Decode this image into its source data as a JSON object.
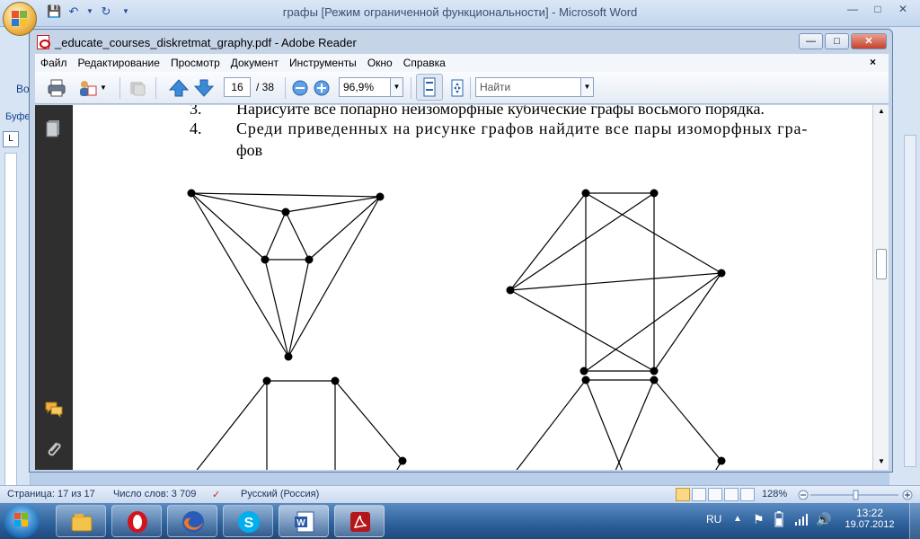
{
  "word": {
    "title": "графы [Режим ограниченной функциональности] - Microsoft Word",
    "left_label_1": "Во",
    "left_label_2": "Буфе",
    "ruler_button": "L"
  },
  "reader": {
    "title": "_educate_courses_diskretmat_graphy.pdf - Adobe Reader",
    "menu": [
      "Файл",
      "Редактирование",
      "Просмотр",
      "Документ",
      "Инструменты",
      "Окно",
      "Справка"
    ],
    "menu_close": "×",
    "page_current": "16",
    "page_total": "/ 38",
    "zoom": "96,9%",
    "find_placeholder": "Найти"
  },
  "document": {
    "line3_num": "3.",
    "line3_text": "Нарисуйте все попарно неизоморфные кубические графы восьмого порядка.",
    "line4_num": "4.",
    "line4_text": "Среди приведенных на рисунке графов найдите все пары изоморфных гра-",
    "line4_cont": "фов"
  },
  "statusbar": {
    "page": "Страница: 17 из 17",
    "words": "Число слов: 3 709",
    "language": "Русский (Россия)",
    "zoom": "128%"
  },
  "taskbar": {
    "lang": "RU",
    "time": "13:22",
    "date": "19.07.2012"
  }
}
